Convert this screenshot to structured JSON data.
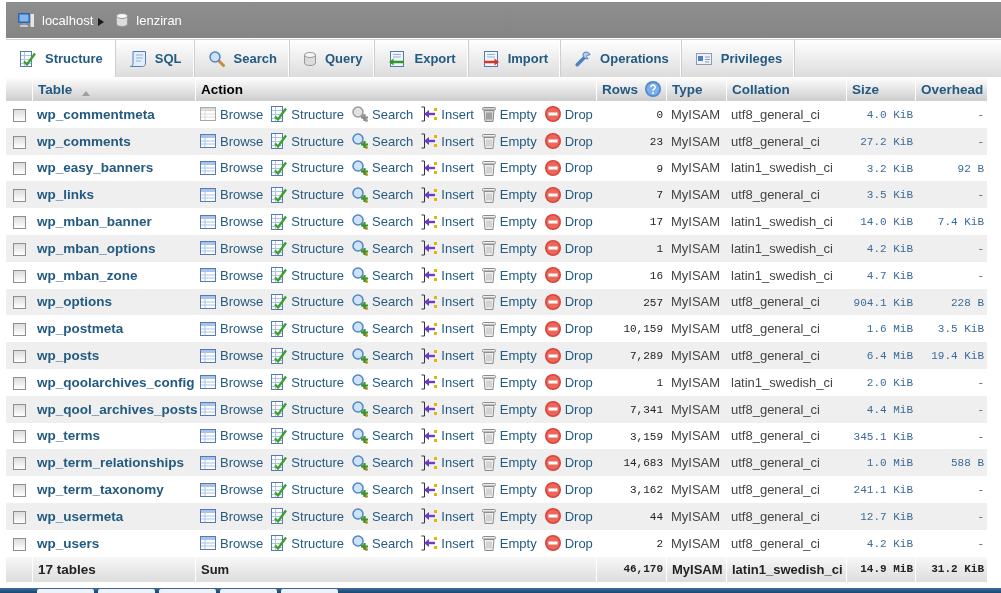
{
  "breadcrumb": [
    {
      "kind": "server",
      "label": "localhost"
    },
    {
      "kind": "database",
      "label": "lenziran"
    }
  ],
  "tabs": [
    {
      "kind": "structure",
      "label": "Structure",
      "selected": true
    },
    {
      "kind": "sql",
      "label": "SQL",
      "selected": false
    },
    {
      "kind": "search",
      "label": "Search",
      "selected": false
    },
    {
      "kind": "query",
      "label": "Query",
      "selected": false
    },
    {
      "kind": "export",
      "label": "Export",
      "selected": false
    },
    {
      "kind": "import",
      "label": "Import",
      "selected": false
    },
    {
      "kind": "operations",
      "label": "Operations",
      "selected": false
    },
    {
      "kind": "privileges",
      "label": "Privileges",
      "selected": false
    }
  ],
  "table": {
    "columns": [
      {
        "kind": "sorted",
        "label": "Table"
      },
      {
        "kind": "plain",
        "label": "Action"
      },
      {
        "kind": "help",
        "label": "Rows"
      },
      {
        "kind": "link",
        "label": "Type"
      },
      {
        "kind": "link",
        "label": "Collation"
      },
      {
        "kind": "link",
        "label": "Size"
      },
      {
        "kind": "link",
        "label": "Overhead"
      }
    ],
    "rows": [
      {
        "name": "wp_commentmeta",
        "checked": false,
        "actions": [
          {
            "kind": "browse",
            "label": "Browse",
            "disabled": true
          },
          {
            "kind": "structure",
            "label": "Structure",
            "disabled": false
          },
          {
            "kind": "search",
            "label": "Search",
            "disabled": true
          },
          {
            "kind": "insert",
            "label": "Insert",
            "disabled": false
          },
          {
            "kind": "empty",
            "label": "Empty",
            "disabled": true
          },
          {
            "kind": "drop",
            "label": "Drop",
            "disabled": false
          }
        ],
        "rows": "0",
        "type": "MyISAM",
        "collation": "utf8_general_ci",
        "size": "4.0 KiB",
        "overhead": "-"
      },
      {
        "name": "wp_comments",
        "checked": false,
        "actions": [
          {
            "kind": "browse",
            "label": "Browse",
            "disabled": false
          },
          {
            "kind": "structure",
            "label": "Structure",
            "disabled": false
          },
          {
            "kind": "search",
            "label": "Search",
            "disabled": false
          },
          {
            "kind": "insert",
            "label": "Insert",
            "disabled": false
          },
          {
            "kind": "empty",
            "label": "Empty",
            "disabled": false
          },
          {
            "kind": "drop",
            "label": "Drop",
            "disabled": false
          }
        ],
        "rows": "23",
        "type": "MyISAM",
        "collation": "utf8_general_ci",
        "size": "27.2 KiB",
        "overhead": "-"
      },
      {
        "name": "wp_easy_banners",
        "checked": false,
        "actions": [
          {
            "kind": "browse",
            "label": "Browse",
            "disabled": false
          },
          {
            "kind": "structure",
            "label": "Structure",
            "disabled": false
          },
          {
            "kind": "search",
            "label": "Search",
            "disabled": false
          },
          {
            "kind": "insert",
            "label": "Insert",
            "disabled": false
          },
          {
            "kind": "empty",
            "label": "Empty",
            "disabled": false
          },
          {
            "kind": "drop",
            "label": "Drop",
            "disabled": false
          }
        ],
        "rows": "9",
        "type": "MyISAM",
        "collation": "latin1_swedish_ci",
        "size": "3.2 KiB",
        "overhead": "92 B"
      },
      {
        "name": "wp_links",
        "checked": false,
        "actions": [
          {
            "kind": "browse",
            "label": "Browse",
            "disabled": false
          },
          {
            "kind": "structure",
            "label": "Structure",
            "disabled": false
          },
          {
            "kind": "search",
            "label": "Search",
            "disabled": false
          },
          {
            "kind": "insert",
            "label": "Insert",
            "disabled": false
          },
          {
            "kind": "empty",
            "label": "Empty",
            "disabled": false
          },
          {
            "kind": "drop",
            "label": "Drop",
            "disabled": false
          }
        ],
        "rows": "7",
        "type": "MyISAM",
        "collation": "utf8_general_ci",
        "size": "3.5 KiB",
        "overhead": "-"
      },
      {
        "name": "wp_mban_banner",
        "checked": false,
        "actions": [
          {
            "kind": "browse",
            "label": "Browse",
            "disabled": false
          },
          {
            "kind": "structure",
            "label": "Structure",
            "disabled": false
          },
          {
            "kind": "search",
            "label": "Search",
            "disabled": false
          },
          {
            "kind": "insert",
            "label": "Insert",
            "disabled": false
          },
          {
            "kind": "empty",
            "label": "Empty",
            "disabled": false
          },
          {
            "kind": "drop",
            "label": "Drop",
            "disabled": false
          }
        ],
        "rows": "17",
        "type": "MyISAM",
        "collation": "latin1_swedish_ci",
        "size": "14.0 KiB",
        "overhead": "7.4 KiB"
      },
      {
        "name": "wp_mban_options",
        "checked": false,
        "actions": [
          {
            "kind": "browse",
            "label": "Browse",
            "disabled": false
          },
          {
            "kind": "structure",
            "label": "Structure",
            "disabled": false
          },
          {
            "kind": "search",
            "label": "Search",
            "disabled": false
          },
          {
            "kind": "insert",
            "label": "Insert",
            "disabled": false
          },
          {
            "kind": "empty",
            "label": "Empty",
            "disabled": false
          },
          {
            "kind": "drop",
            "label": "Drop",
            "disabled": false
          }
        ],
        "rows": "1",
        "type": "MyISAM",
        "collation": "latin1_swedish_ci",
        "size": "4.2 KiB",
        "overhead": "-"
      },
      {
        "name": "wp_mban_zone",
        "checked": false,
        "actions": [
          {
            "kind": "browse",
            "label": "Browse",
            "disabled": false
          },
          {
            "kind": "structure",
            "label": "Structure",
            "disabled": false
          },
          {
            "kind": "search",
            "label": "Search",
            "disabled": false
          },
          {
            "kind": "insert",
            "label": "Insert",
            "disabled": false
          },
          {
            "kind": "empty",
            "label": "Empty",
            "disabled": false
          },
          {
            "kind": "drop",
            "label": "Drop",
            "disabled": false
          }
        ],
        "rows": "16",
        "type": "MyISAM",
        "collation": "latin1_swedish_ci",
        "size": "4.7 KiB",
        "overhead": "-"
      },
      {
        "name": "wp_options",
        "checked": false,
        "actions": [
          {
            "kind": "browse",
            "label": "Browse",
            "disabled": false
          },
          {
            "kind": "structure",
            "label": "Structure",
            "disabled": false
          },
          {
            "kind": "search",
            "label": "Search",
            "disabled": false
          },
          {
            "kind": "insert",
            "label": "Insert",
            "disabled": false
          },
          {
            "kind": "empty",
            "label": "Empty",
            "disabled": false
          },
          {
            "kind": "drop",
            "label": "Drop",
            "disabled": false
          }
        ],
        "rows": "257",
        "type": "MyISAM",
        "collation": "utf8_general_ci",
        "size": "904.1 KiB",
        "overhead": "228 B"
      },
      {
        "name": "wp_postmeta",
        "checked": false,
        "actions": [
          {
            "kind": "browse",
            "label": "Browse",
            "disabled": false
          },
          {
            "kind": "structure",
            "label": "Structure",
            "disabled": false
          },
          {
            "kind": "search",
            "label": "Search",
            "disabled": false
          },
          {
            "kind": "insert",
            "label": "Insert",
            "disabled": false
          },
          {
            "kind": "empty",
            "label": "Empty",
            "disabled": false
          },
          {
            "kind": "drop",
            "label": "Drop",
            "disabled": false
          }
        ],
        "rows": "10,159",
        "type": "MyISAM",
        "collation": "utf8_general_ci",
        "size": "1.6 MiB",
        "overhead": "3.5 KiB"
      },
      {
        "name": "wp_posts",
        "checked": false,
        "actions": [
          {
            "kind": "browse",
            "label": "Browse",
            "disabled": false
          },
          {
            "kind": "structure",
            "label": "Structure",
            "disabled": false
          },
          {
            "kind": "search",
            "label": "Search",
            "disabled": false
          },
          {
            "kind": "insert",
            "label": "Insert",
            "disabled": false
          },
          {
            "kind": "empty",
            "label": "Empty",
            "disabled": false
          },
          {
            "kind": "drop",
            "label": "Drop",
            "disabled": false
          }
        ],
        "rows": "7,289",
        "type": "MyISAM",
        "collation": "utf8_general_ci",
        "size": "6.4 MiB",
        "overhead": "19.4 KiB"
      },
      {
        "name": "wp_qoolarchives_config",
        "checked": false,
        "actions": [
          {
            "kind": "browse",
            "label": "Browse",
            "disabled": false
          },
          {
            "kind": "structure",
            "label": "Structure",
            "disabled": false
          },
          {
            "kind": "search",
            "label": "Search",
            "disabled": false
          },
          {
            "kind": "insert",
            "label": "Insert",
            "disabled": false
          },
          {
            "kind": "empty",
            "label": "Empty",
            "disabled": false
          },
          {
            "kind": "drop",
            "label": "Drop",
            "disabled": false
          }
        ],
        "rows": "1",
        "type": "MyISAM",
        "collation": "latin1_swedish_ci",
        "size": "2.0 KiB",
        "overhead": "-"
      },
      {
        "name": "wp_qool_archives_posts",
        "checked": false,
        "actions": [
          {
            "kind": "browse",
            "label": "Browse",
            "disabled": false
          },
          {
            "kind": "structure",
            "label": "Structure",
            "disabled": false
          },
          {
            "kind": "search",
            "label": "Search",
            "disabled": false
          },
          {
            "kind": "insert",
            "label": "Insert",
            "disabled": false
          },
          {
            "kind": "empty",
            "label": "Empty",
            "disabled": false
          },
          {
            "kind": "drop",
            "label": "Drop",
            "disabled": false
          }
        ],
        "rows": "7,341",
        "type": "MyISAM",
        "collation": "utf8_general_ci",
        "size": "4.4 MiB",
        "overhead": "-"
      },
      {
        "name": "wp_terms",
        "checked": false,
        "actions": [
          {
            "kind": "browse",
            "label": "Browse",
            "disabled": false
          },
          {
            "kind": "structure",
            "label": "Structure",
            "disabled": false
          },
          {
            "kind": "search",
            "label": "Search",
            "disabled": false
          },
          {
            "kind": "insert",
            "label": "Insert",
            "disabled": false
          },
          {
            "kind": "empty",
            "label": "Empty",
            "disabled": false
          },
          {
            "kind": "drop",
            "label": "Drop",
            "disabled": false
          }
        ],
        "rows": "3,159",
        "type": "MyISAM",
        "collation": "utf8_general_ci",
        "size": "345.1 KiB",
        "overhead": "-"
      },
      {
        "name": "wp_term_relationships",
        "checked": false,
        "actions": [
          {
            "kind": "browse",
            "label": "Browse",
            "disabled": false
          },
          {
            "kind": "structure",
            "label": "Structure",
            "disabled": false
          },
          {
            "kind": "search",
            "label": "Search",
            "disabled": false
          },
          {
            "kind": "insert",
            "label": "Insert",
            "disabled": false
          },
          {
            "kind": "empty",
            "label": "Empty",
            "disabled": false
          },
          {
            "kind": "drop",
            "label": "Drop",
            "disabled": false
          }
        ],
        "rows": "14,683",
        "type": "MyISAM",
        "collation": "utf8_general_ci",
        "size": "1.0 MiB",
        "overhead": "588 B"
      },
      {
        "name": "wp_term_taxonomy",
        "checked": false,
        "actions": [
          {
            "kind": "browse",
            "label": "Browse",
            "disabled": false
          },
          {
            "kind": "structure",
            "label": "Structure",
            "disabled": false
          },
          {
            "kind": "search",
            "label": "Search",
            "disabled": false
          },
          {
            "kind": "insert",
            "label": "Insert",
            "disabled": false
          },
          {
            "kind": "empty",
            "label": "Empty",
            "disabled": false
          },
          {
            "kind": "drop",
            "label": "Drop",
            "disabled": false
          }
        ],
        "rows": "3,162",
        "type": "MyISAM",
        "collation": "utf8_general_ci",
        "size": "241.1 KiB",
        "overhead": "-"
      },
      {
        "name": "wp_usermeta",
        "checked": false,
        "actions": [
          {
            "kind": "browse",
            "label": "Browse",
            "disabled": false
          },
          {
            "kind": "structure",
            "label": "Structure",
            "disabled": false
          },
          {
            "kind": "search",
            "label": "Search",
            "disabled": false
          },
          {
            "kind": "insert",
            "label": "Insert",
            "disabled": false
          },
          {
            "kind": "empty",
            "label": "Empty",
            "disabled": false
          },
          {
            "kind": "drop",
            "label": "Drop",
            "disabled": false
          }
        ],
        "rows": "44",
        "type": "MyISAM",
        "collation": "utf8_general_ci",
        "size": "12.7 KiB",
        "overhead": "-"
      },
      {
        "name": "wp_users",
        "checked": false,
        "actions": [
          {
            "kind": "browse",
            "label": "Browse",
            "disabled": false
          },
          {
            "kind": "structure",
            "label": "Structure",
            "disabled": false
          },
          {
            "kind": "search",
            "label": "Search",
            "disabled": false
          },
          {
            "kind": "insert",
            "label": "Insert",
            "disabled": false
          },
          {
            "kind": "empty",
            "label": "Empty",
            "disabled": false
          },
          {
            "kind": "drop",
            "label": "Drop",
            "disabled": false
          }
        ],
        "rows": "2",
        "type": "MyISAM",
        "collation": "utf8_general_ci",
        "size": "4.2 KiB",
        "overhead": "-"
      }
    ],
    "summary": {
      "label": "17 tables",
      "action": "Sum",
      "rows": "46,170",
      "type": "MyISAM",
      "collation": "latin1_swedish_ci",
      "size": "14.9 MiB",
      "overhead": "31.2 KiB"
    }
  }
}
